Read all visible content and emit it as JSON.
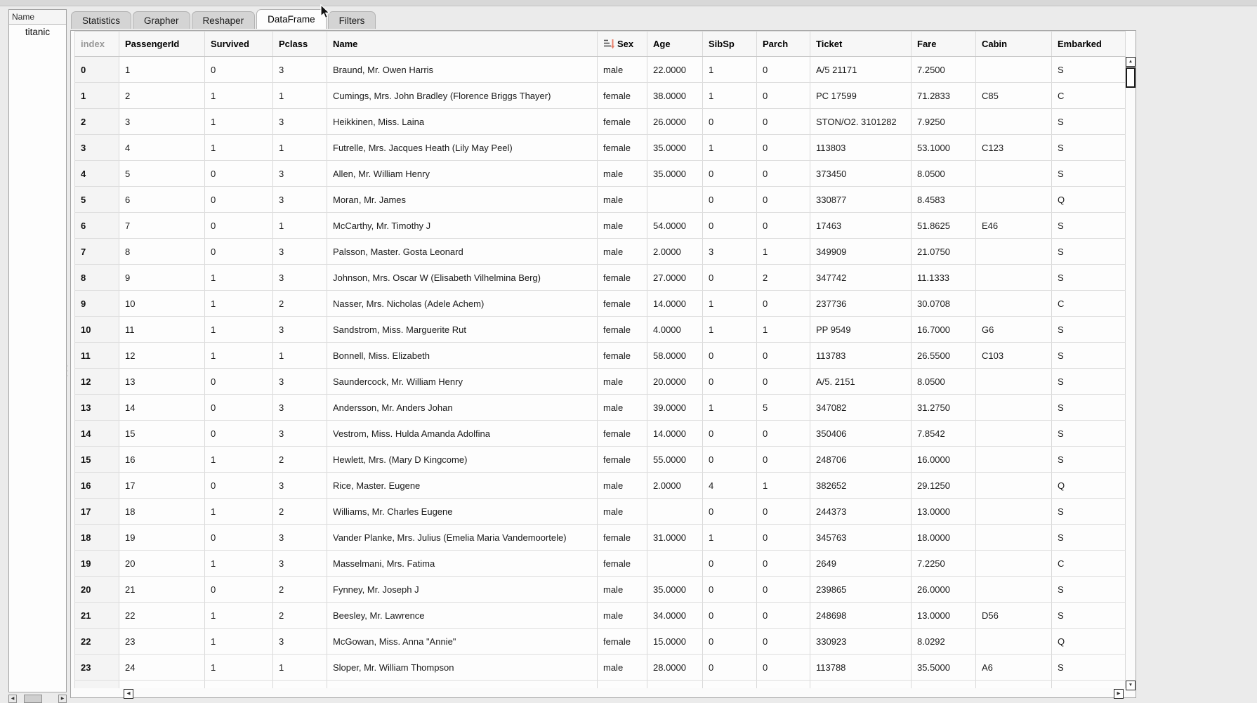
{
  "sidebar": {
    "header_label": "Name",
    "items": [
      {
        "label": "titanic"
      }
    ]
  },
  "tabs": [
    {
      "label": "Statistics",
      "active": false
    },
    {
      "label": "Grapher",
      "active": false
    },
    {
      "label": "Reshaper",
      "active": false
    },
    {
      "label": "DataFrame",
      "active": true
    },
    {
      "label": "Filters",
      "active": false
    }
  ],
  "dataframe": {
    "columns": [
      "index",
      "PassengerId",
      "Survived",
      "Pclass",
      "Name",
      "Sex",
      "Age",
      "SibSp",
      "Parch",
      "Ticket",
      "Fare",
      "Cabin",
      "Embarked"
    ],
    "sorted_by": "Sex",
    "rows": [
      [
        "0",
        "1",
        "0",
        "3",
        "Braund, Mr. Owen Harris",
        "male",
        "22.0000",
        "1",
        "0",
        "A/5 21171",
        "7.2500",
        "",
        "S"
      ],
      [
        "1",
        "2",
        "1",
        "1",
        "Cumings, Mrs. John Bradley (Florence Briggs Thayer)",
        "female",
        "38.0000",
        "1",
        "0",
        "PC 17599",
        "71.2833",
        "C85",
        "C"
      ],
      [
        "2",
        "3",
        "1",
        "3",
        "Heikkinen, Miss. Laina",
        "female",
        "26.0000",
        "0",
        "0",
        "STON/O2. 3101282",
        "7.9250",
        "",
        "S"
      ],
      [
        "3",
        "4",
        "1",
        "1",
        "Futrelle, Mrs. Jacques Heath (Lily May Peel)",
        "female",
        "35.0000",
        "1",
        "0",
        "113803",
        "53.1000",
        "C123",
        "S"
      ],
      [
        "4",
        "5",
        "0",
        "3",
        "Allen, Mr. William Henry",
        "male",
        "35.0000",
        "0",
        "0",
        "373450",
        "8.0500",
        "",
        "S"
      ],
      [
        "5",
        "6",
        "0",
        "3",
        "Moran, Mr. James",
        "male",
        "",
        "0",
        "0",
        "330877",
        "8.4583",
        "",
        "Q"
      ],
      [
        "6",
        "7",
        "0",
        "1",
        "McCarthy, Mr. Timothy J",
        "male",
        "54.0000",
        "0",
        "0",
        "17463",
        "51.8625",
        "E46",
        "S"
      ],
      [
        "7",
        "8",
        "0",
        "3",
        "Palsson, Master. Gosta Leonard",
        "male",
        "2.0000",
        "3",
        "1",
        "349909",
        "21.0750",
        "",
        "S"
      ],
      [
        "8",
        "9",
        "1",
        "3",
        "Johnson, Mrs. Oscar W (Elisabeth Vilhelmina Berg)",
        "female",
        "27.0000",
        "0",
        "2",
        "347742",
        "11.1333",
        "",
        "S"
      ],
      [
        "9",
        "10",
        "1",
        "2",
        "Nasser, Mrs. Nicholas (Adele Achem)",
        "female",
        "14.0000",
        "1",
        "0",
        "237736",
        "30.0708",
        "",
        "C"
      ],
      [
        "10",
        "11",
        "1",
        "3",
        "Sandstrom, Miss. Marguerite Rut",
        "female",
        "4.0000",
        "1",
        "1",
        "PP 9549",
        "16.7000",
        "G6",
        "S"
      ],
      [
        "11",
        "12",
        "1",
        "1",
        "Bonnell, Miss. Elizabeth",
        "female",
        "58.0000",
        "0",
        "0",
        "113783",
        "26.5500",
        "C103",
        "S"
      ],
      [
        "12",
        "13",
        "0",
        "3",
        "Saundercock, Mr. William Henry",
        "male",
        "20.0000",
        "0",
        "0",
        "A/5. 2151",
        "8.0500",
        "",
        "S"
      ],
      [
        "13",
        "14",
        "0",
        "3",
        "Andersson, Mr. Anders Johan",
        "male",
        "39.0000",
        "1",
        "5",
        "347082",
        "31.2750",
        "",
        "S"
      ],
      [
        "14",
        "15",
        "0",
        "3",
        "Vestrom, Miss. Hulda Amanda Adolfina",
        "female",
        "14.0000",
        "0",
        "0",
        "350406",
        "7.8542",
        "",
        "S"
      ],
      [
        "15",
        "16",
        "1",
        "2",
        "Hewlett, Mrs. (Mary D Kingcome)",
        "female",
        "55.0000",
        "0",
        "0",
        "248706",
        "16.0000",
        "",
        "S"
      ],
      [
        "16",
        "17",
        "0",
        "3",
        "Rice, Master. Eugene",
        "male",
        "2.0000",
        "4",
        "1",
        "382652",
        "29.1250",
        "",
        "Q"
      ],
      [
        "17",
        "18",
        "1",
        "2",
        "Williams, Mr. Charles Eugene",
        "male",
        "",
        "0",
        "0",
        "244373",
        "13.0000",
        "",
        "S"
      ],
      [
        "18",
        "19",
        "0",
        "3",
        "Vander Planke, Mrs. Julius (Emelia Maria Vandemoortele)",
        "female",
        "31.0000",
        "1",
        "0",
        "345763",
        "18.0000",
        "",
        "S"
      ],
      [
        "19",
        "20",
        "1",
        "3",
        "Masselmani, Mrs. Fatima",
        "female",
        "",
        "0",
        "0",
        "2649",
        "7.2250",
        "",
        "C"
      ],
      [
        "20",
        "21",
        "0",
        "2",
        "Fynney, Mr. Joseph J",
        "male",
        "35.0000",
        "0",
        "0",
        "239865",
        "26.0000",
        "",
        "S"
      ],
      [
        "21",
        "22",
        "1",
        "2",
        "Beesley, Mr. Lawrence",
        "male",
        "34.0000",
        "0",
        "0",
        "248698",
        "13.0000",
        "D56",
        "S"
      ],
      [
        "22",
        "23",
        "1",
        "3",
        "McGowan, Miss. Anna \"Annie\"",
        "female",
        "15.0000",
        "0",
        "0",
        "330923",
        "8.0292",
        "",
        "Q"
      ],
      [
        "23",
        "24",
        "1",
        "1",
        "Sloper, Mr. William Thompson",
        "male",
        "28.0000",
        "0",
        "0",
        "113788",
        "35.5000",
        "A6",
        "S"
      ]
    ]
  },
  "icons": {
    "scroll_up": "▲",
    "scroll_down": "▼",
    "scroll_left": "◀",
    "scroll_right": "▶",
    "sort_indicator": "sort-lines-with-down-arrow"
  },
  "colors": {
    "sort_arrow_accent": "#e8806b",
    "sort_lines": "#4d4d4d"
  }
}
